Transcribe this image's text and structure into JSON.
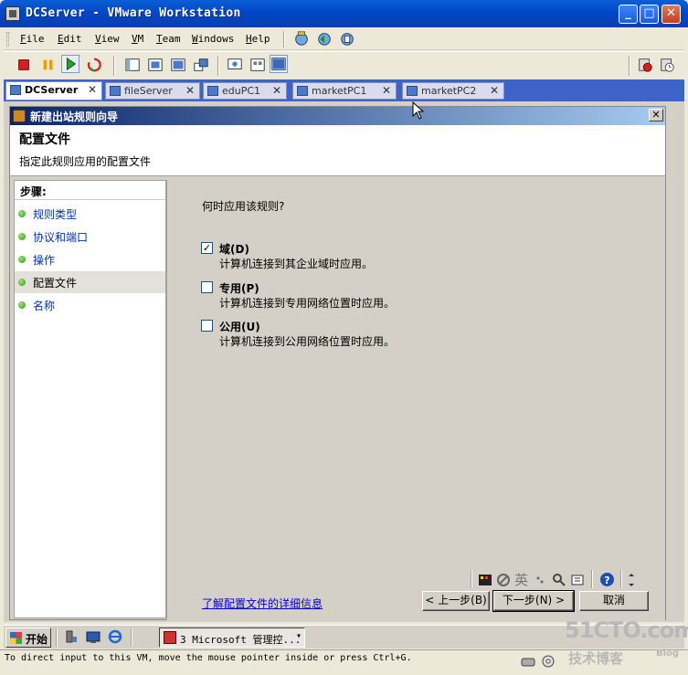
{
  "window": {
    "title": "DCServer - VMware Workstation",
    "minimize": "_",
    "maximize": "□",
    "close": "✕"
  },
  "menu": [
    "File",
    "Edit",
    "View",
    "VM",
    "Team",
    "Windows",
    "Help"
  ],
  "tabs": [
    {
      "label": "DCServer",
      "active": true
    },
    {
      "label": "fileServer",
      "active": false
    },
    {
      "label": "eduPC1",
      "active": false
    },
    {
      "label": "marketPC1",
      "active": false
    },
    {
      "label": "marketPC2",
      "active": false
    }
  ],
  "tab_close": "✕",
  "dialog": {
    "title": "新建出站规则向导",
    "close": "✕",
    "header_title": "配置文件",
    "header_subtitle": "指定此规则应用的配置文件",
    "steps_title": "步骤:",
    "steps": [
      {
        "label": "规则类型",
        "current": false
      },
      {
        "label": "协议和端口",
        "current": false
      },
      {
        "label": "操作",
        "current": false
      },
      {
        "label": "配置文件",
        "current": true
      },
      {
        "label": "名称",
        "current": false
      }
    ],
    "question": "何时应用该规则?",
    "options": [
      {
        "label": "域(D)",
        "desc": "计算机连接到其企业域时应用。",
        "checked": true
      },
      {
        "label": "专用(P)",
        "desc": "计算机连接到专用网络位置时应用。",
        "checked": false
      },
      {
        "label": "公用(U)",
        "desc": "计算机连接到公用网络位置时应用。",
        "checked": false
      }
    ],
    "checkmark": "✓",
    "learn_more": "了解配置文件的详细信息",
    "buttons": {
      "back": "< 上一步(B)",
      "next": "下一步(N) >",
      "cancel": "取消"
    },
    "ime": {
      "lang": "英",
      "help": "?"
    }
  },
  "taskbar": {
    "start": "开始",
    "task_item": "3 Microsoft 管理控...",
    "task_dropdown": "▾"
  },
  "status": {
    "text": "To direct input to this VM, move the mouse pointer inside or press Ctrl+G."
  },
  "watermark": {
    "line1": "51CTO.com",
    "line2": "技术博客",
    "line3": "Blog"
  },
  "colors": {
    "titlebar": "#0a5fd6",
    "tabstrip": "#3d63c8",
    "dialog_title": "#0a246a",
    "link": "#0000cc",
    "step_dot": "#2e9a17"
  }
}
